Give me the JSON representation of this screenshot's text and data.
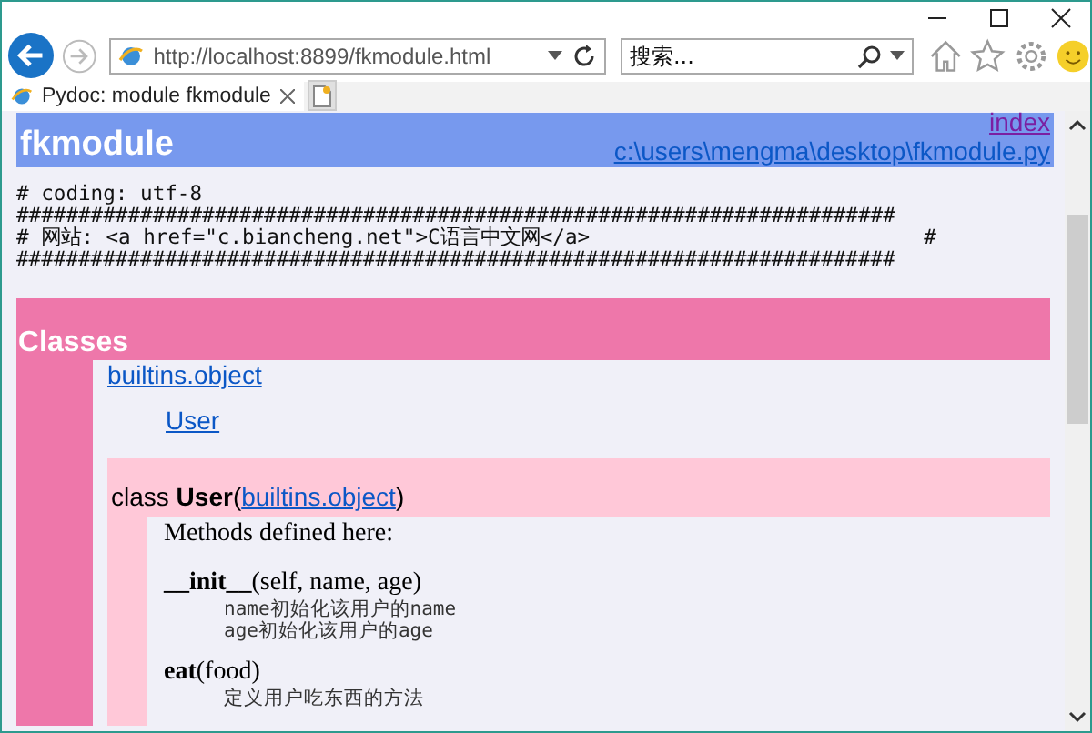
{
  "browser": {
    "address": "http://localhost:8899/fkmodule.html",
    "search": {
      "placeholder": "搜索..."
    },
    "tabs": [
      {
        "label": "Pydoc: module fkmodule",
        "selected": true
      }
    ]
  },
  "page": {
    "title": "fkmodule",
    "links": [
      "index",
      "c:\\users\\mengma\\desktop\\fkmodule.py"
    ],
    "source_lines": [
      "# coding: utf-8",
      "#######################################################################",
      "# 网站: <a href=\"c.biancheng.net\">C语言中文网</a>                           #",
      "#######################################################################"
    ],
    "classes": {
      "title": "Classes",
      "tree": [
        {
          "label": "builtins.object",
          "children": [
            {
              "label": "User"
            }
          ]
        }
      ],
      "class_block": {
        "keyword": "class",
        "name": "User",
        "paren_open": "(",
        "base": "builtins.object",
        "paren_close": ")",
        "intro": "Methods defined here:",
        "methods": [
          {
            "name": "__init__",
            "args": "(self, name, age)",
            "doc": [
              "name初始化该用户的name",
              "age初始化该用户的age"
            ]
          },
          {
            "name": "eat",
            "args": "(food)",
            "doc": [
              "定义用户吃东西的方法"
            ]
          }
        ]
      }
    }
  }
}
